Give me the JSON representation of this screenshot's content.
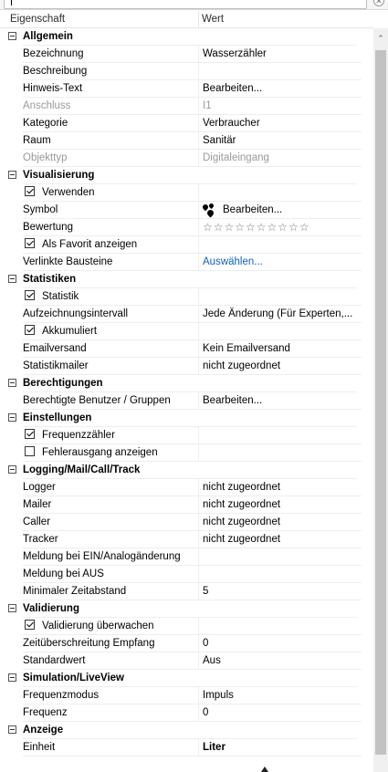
{
  "header": {
    "col_property": "Eigenschaft",
    "col_value": "Wert"
  },
  "icons": {
    "clear": "close-icon",
    "scroll_up": "chevron-up-icon",
    "expander": "minus-box-icon"
  },
  "colors": {
    "link": "#0b64c0",
    "disabled": "#9a9a9a"
  },
  "rows": [
    {
      "type": "cat",
      "name": "Allgemein"
    },
    {
      "name": "Bezeichnung",
      "value": "Wasserzähler"
    },
    {
      "name": "Beschreibung",
      "value": ""
    },
    {
      "name": "Hinweis-Text",
      "value": "Bearbeiten..."
    },
    {
      "name": "Anschluss",
      "value": "I1",
      "disabled": true
    },
    {
      "name": "Kategorie",
      "value": "Verbraucher"
    },
    {
      "name": "Raum",
      "value": "Sanitär"
    },
    {
      "name": "Objekttyp",
      "value": "Digitaleingang",
      "disabled": true
    },
    {
      "type": "cat",
      "name": "Visualisierung"
    },
    {
      "name": "Verwenden",
      "value": "",
      "check": true
    },
    {
      "name": "Symbol",
      "value": "Bearbeiten...",
      "icon": "water-drops-icon"
    },
    {
      "name": "Bewertung",
      "value": "☆☆☆☆☆☆☆☆☆☆",
      "stars": true
    },
    {
      "name": "Als Favorit anzeigen",
      "value": "",
      "check": true
    },
    {
      "name": "Verlinkte Bausteine",
      "value": "Auswählen...",
      "link": true
    },
    {
      "type": "cat",
      "name": "Statistiken"
    },
    {
      "name": "Statistik",
      "value": "",
      "check": true
    },
    {
      "name": "Aufzeichnungsintervall",
      "value": "Jede Änderung (Für Experten,..."
    },
    {
      "name": "Akkumuliert",
      "value": "",
      "check": true
    },
    {
      "name": "Emailversand",
      "value": "Kein Emailversand"
    },
    {
      "name": "Statistikmailer",
      "value": "nicht zugeordnet"
    },
    {
      "type": "cat",
      "name": "Berechtigungen"
    },
    {
      "name": "Berechtigte Benutzer / Gruppen",
      "value": "Bearbeiten..."
    },
    {
      "type": "cat",
      "name": "Einstellungen"
    },
    {
      "name": "Frequenzzähler",
      "value": "",
      "check": true
    },
    {
      "name": "Fehlerausgang anzeigen",
      "value": "",
      "check": false
    },
    {
      "type": "cat",
      "name": "Logging/Mail/Call/Track"
    },
    {
      "name": "Logger",
      "value": "nicht zugeordnet"
    },
    {
      "name": "Mailer",
      "value": "nicht zugeordnet"
    },
    {
      "name": "Caller",
      "value": "nicht zugeordnet"
    },
    {
      "name": "Tracker",
      "value": "nicht zugeordnet"
    },
    {
      "name": "Meldung bei EIN/Analogänderung",
      "value": ""
    },
    {
      "name": "Meldung bei AUS",
      "value": ""
    },
    {
      "name": "Minimaler Zeitabstand",
      "value": "5"
    },
    {
      "type": "cat",
      "name": "Validierung"
    },
    {
      "name": "Validierung überwachen",
      "value": "",
      "check": true
    },
    {
      "name": "Zeitüberschreitung Empfang",
      "value": "0"
    },
    {
      "name": "Standardwert",
      "value": "Aus"
    },
    {
      "type": "cat",
      "name": "Simulation/LiveView"
    },
    {
      "name": "Frequenzmodus",
      "value": "Impuls"
    },
    {
      "name": "Frequenz",
      "value": "0"
    },
    {
      "type": "cat",
      "name": "Anzeige"
    },
    {
      "name": "Einheit",
      "value": "Liter",
      "bold": true
    }
  ]
}
